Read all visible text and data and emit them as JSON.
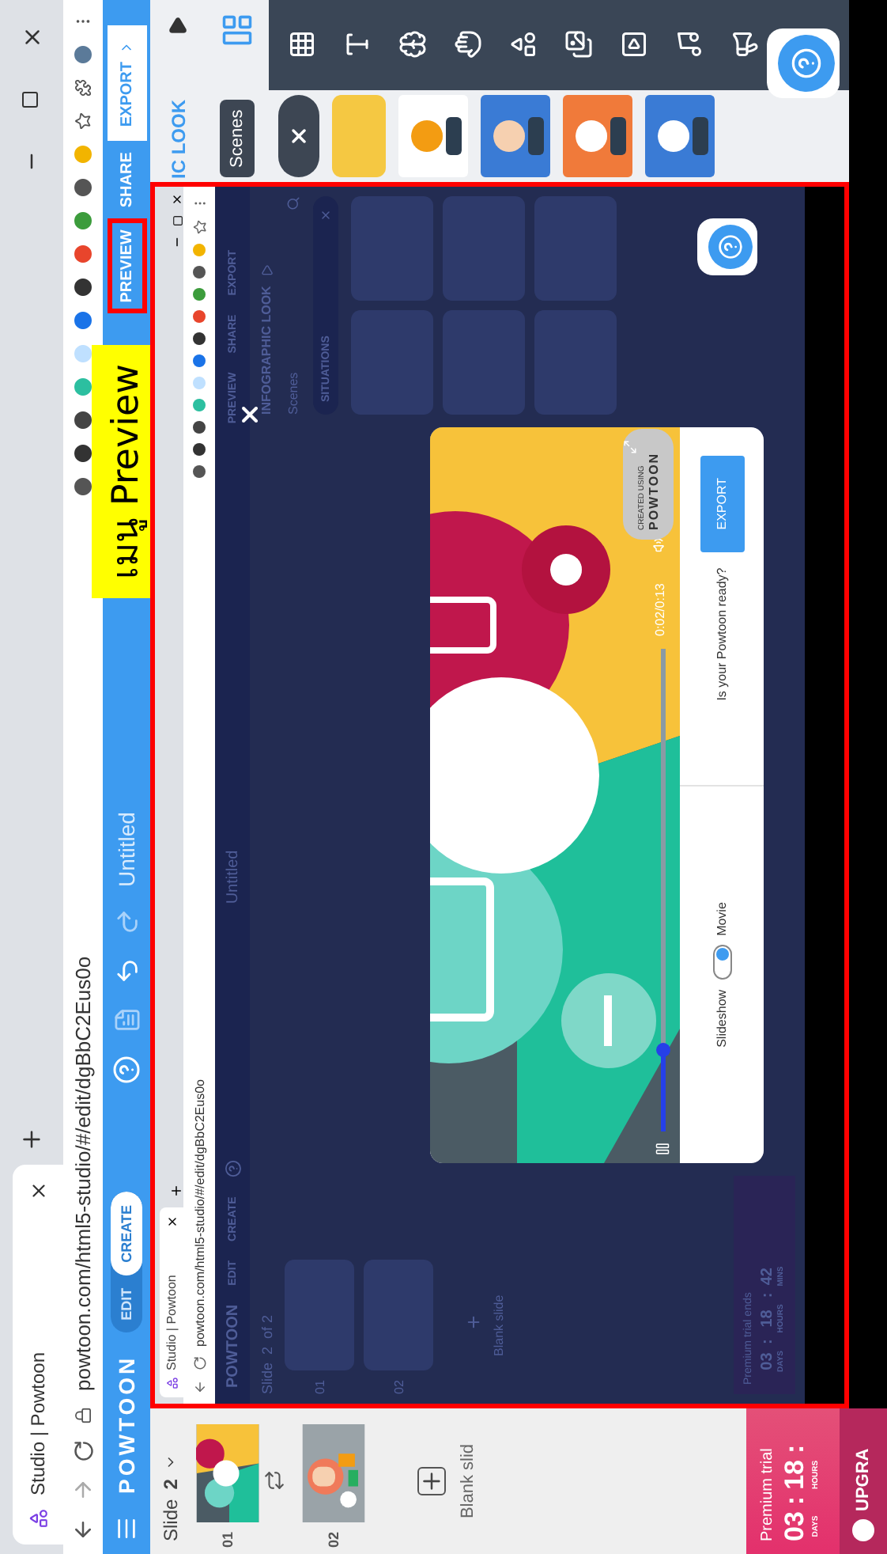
{
  "browser": {
    "tab_title": "Studio | Powtoon",
    "url": "powtoon.com/html5-studio/#/edit/dgBbC2Eus0o"
  },
  "topbar": {
    "logo": "POWTOON",
    "mode_tabs": [
      {
        "label": "EDIT",
        "selected": false
      },
      {
        "label": "CREATE",
        "selected": true
      }
    ],
    "title": "Untitled",
    "actions": [
      {
        "label": "PREVIEW",
        "kind": "link",
        "highlighted": true
      },
      {
        "label": "SHARE",
        "kind": "link",
        "highlighted": false
      },
      {
        "label": "EXPORT",
        "kind": "button",
        "highlighted": false
      }
    ]
  },
  "annotation": {
    "text": "เมนู Preview"
  },
  "slides_panel": {
    "label": "Slide",
    "current": "2",
    "slides": [
      {
        "number": "01",
        "kind": "vs"
      },
      {
        "number": "02",
        "kind": "person"
      }
    ],
    "blank_slide": "Blank slid",
    "trial": {
      "title": "Premium trial",
      "countdown": [
        {
          "kind": "value",
          "text": "03",
          "unit": "DAYS"
        },
        {
          "kind": "sep",
          "text": ":"
        },
        {
          "kind": "value",
          "text": "18",
          "unit": "HOURS"
        },
        {
          "kind": "sep",
          "text": ":"
        }
      ],
      "upgrade": "UPGRA"
    }
  },
  "library_panel": {
    "header": "IC LOOK",
    "tooltip": "Scenes"
  },
  "embedded": {
    "tab_title": "Studio | Powtoon",
    "url": "powtoon.com/html5-studio/#/edit/dgBbC2Eus0o",
    "topbar": {
      "logo": "POWTOON",
      "modes": [
        "EDIT",
        "CREATE"
      ],
      "title": "Untitled",
      "actions": [
        "PREVIEW",
        "SHARE",
        "EXPORT"
      ]
    },
    "slides": {
      "label": "Slide",
      "current": "2",
      "total": "of 2",
      "numbers": [
        "01",
        "02"
      ],
      "blank_slide": "Blank slide",
      "trial": "Premium trial ends",
      "countdown": [
        {
          "kind": "value",
          "text": "03",
          "unit": "DAYS"
        },
        {
          "kind": "sep",
          "text": ":"
        },
        {
          "kind": "value",
          "text": "18",
          "unit": "HOURS"
        },
        {
          "kind": "sep",
          "text": ":"
        },
        {
          "kind": "value",
          "text": "42",
          "unit": "MINS"
        }
      ]
    },
    "library": {
      "header": "INFOGRAPHIC LOOK",
      "tab": "Scenes",
      "category": "SITUATIONS"
    },
    "preview": {
      "time": "0:02/0:13",
      "level": 0.17,
      "badge_small": "CREATED USING",
      "badge_logo": "POWTOON",
      "mode": {
        "left": "Slideshow",
        "right": "Movie",
        "movie": true
      },
      "prompt": "Is your Powtoon ready?",
      "export": "EXPORT"
    }
  }
}
